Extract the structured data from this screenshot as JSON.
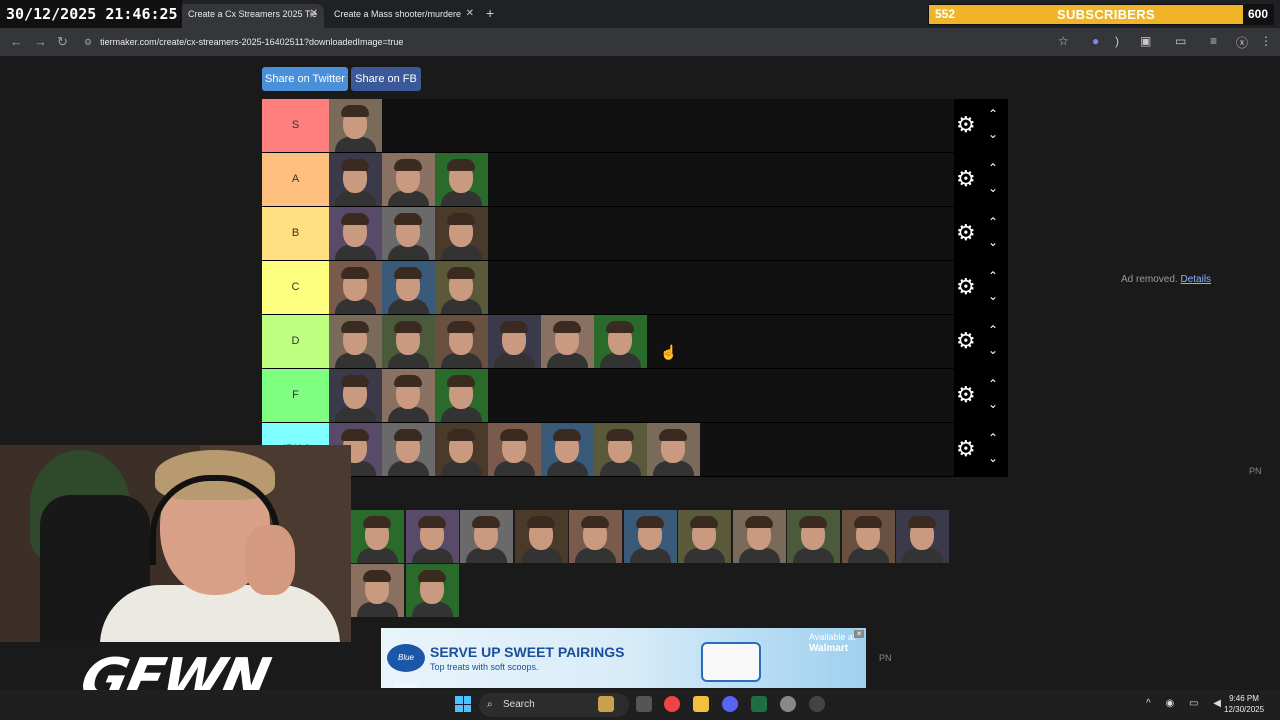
{
  "overlay": {
    "clock": "30/12/2025 21:46:25",
    "subs_current": "552",
    "subs_label": "SUBSCRIBERS",
    "subs_goal": "600",
    "logo": "GEWN"
  },
  "browser": {
    "tabs": [
      {
        "label": "Create a Cx Streamers 2025 Tie"
      },
      {
        "label": "Create a Mass shooter/murdere"
      }
    ],
    "url": "tiermaker.com/create/cx-streamers-2025-16402511?downloadedImage=true"
  },
  "share": {
    "twitter": "Share on Twitter",
    "facebook": "Share on FB"
  },
  "tiers": [
    {
      "label": "S",
      "color": "#ff7f7f",
      "count": 1
    },
    {
      "label": "A",
      "color": "#ffbf7f",
      "count": 3
    },
    {
      "label": "B",
      "color": "#ffdf7f",
      "count": 3
    },
    {
      "label": "C",
      "color": "#ffff7f",
      "count": 3
    },
    {
      "label": "D",
      "color": "#bfff7f",
      "count": 6
    },
    {
      "label": "F",
      "color": "#7fff7f",
      "count": 3
    },
    {
      "label": "IDK /",
      "color": "#7fffff",
      "count": 7
    }
  ],
  "ad_removed": {
    "text": "Ad removed.",
    "link": "Details"
  },
  "pn_label": "PN",
  "ad": {
    "brand": "Blue Bunny",
    "headline": "SERVE UP SWEET PAIRINGS",
    "subline": "Top treats with soft scoops.",
    "avail": "Available at",
    "retailer": "Walmart"
  },
  "taskbar": {
    "search": "Search",
    "time": "9:46 PM",
    "date": "12/30/2025"
  },
  "thumb_palette": [
    "#7a6a5a",
    "#4a5a3a",
    "#6a5040",
    "#3a3a4a",
    "#8a7060",
    "#2a6a2a",
    "#5a4a6a",
    "#6a6a6a",
    "#4a3a2a",
    "#7a5a4a",
    "#3a5a7a",
    "#5a5a3a"
  ]
}
